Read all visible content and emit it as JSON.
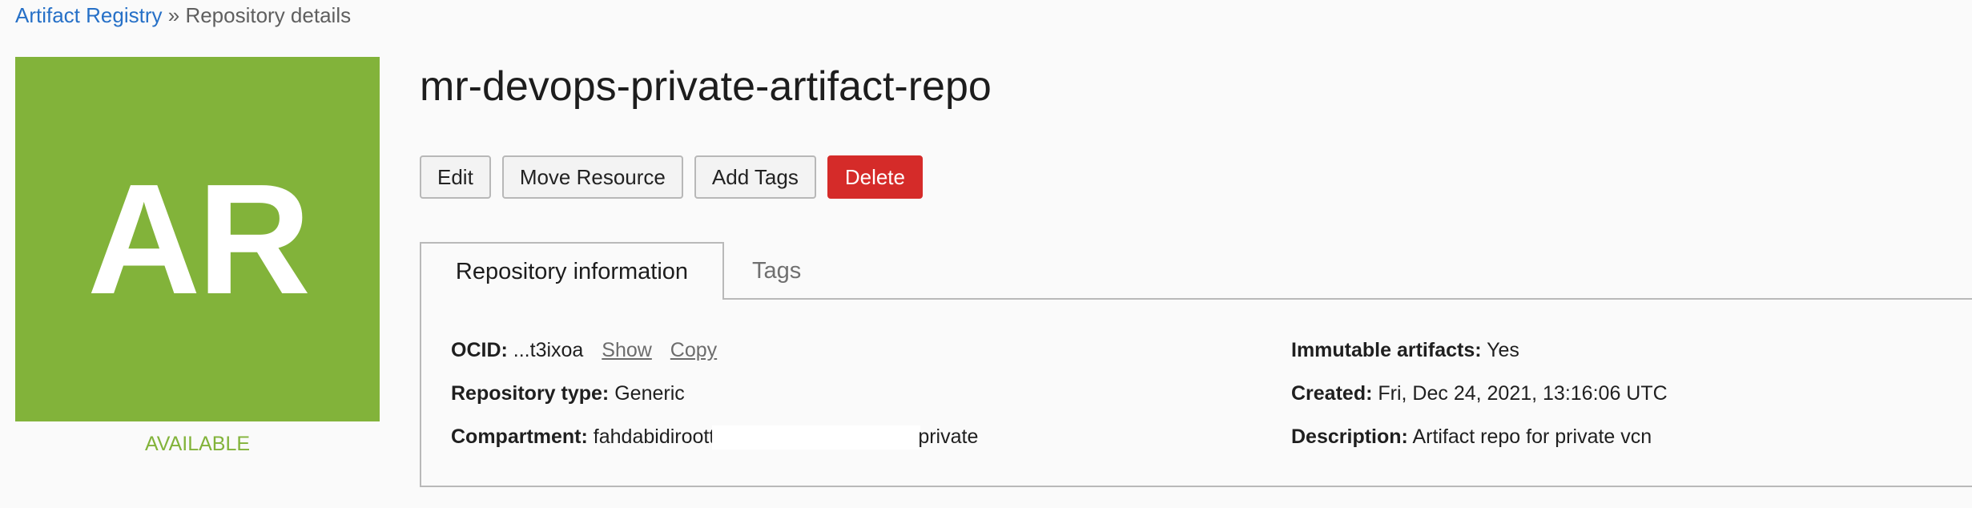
{
  "breadcrumb": {
    "root": "Artifact Registry",
    "separator": "»",
    "current": "Repository details"
  },
  "badge": {
    "initials": "AR",
    "status": "AVAILABLE",
    "color": "#82b33a"
  },
  "title": "mr-devops-private-artifact-repo",
  "actions": {
    "edit": "Edit",
    "move": "Move Resource",
    "add_tags": "Add Tags",
    "delete": "Delete"
  },
  "tabs": {
    "info": "Repository information",
    "tags": "Tags"
  },
  "info": {
    "ocid_label": "OCID:",
    "ocid_value": "...t3ixoa",
    "show": "Show",
    "copy": "Copy",
    "type_label": "Repository type:",
    "type_value": "Generic",
    "compartment_label": "Compartment:",
    "compartment_prefix": "fahdabidiroott",
    "compartment_suffix": "private",
    "immutable_label": "Immutable artifacts:",
    "immutable_value": "Yes",
    "created_label": "Created:",
    "created_value": "Fri, Dec 24, 2021, 13:16:06 UTC",
    "description_label": "Description:",
    "description_value": "Artifact repo for private vcn"
  },
  "colors": {
    "link": "#2670c7",
    "danger": "#d52b29",
    "status": "#82b33a"
  }
}
